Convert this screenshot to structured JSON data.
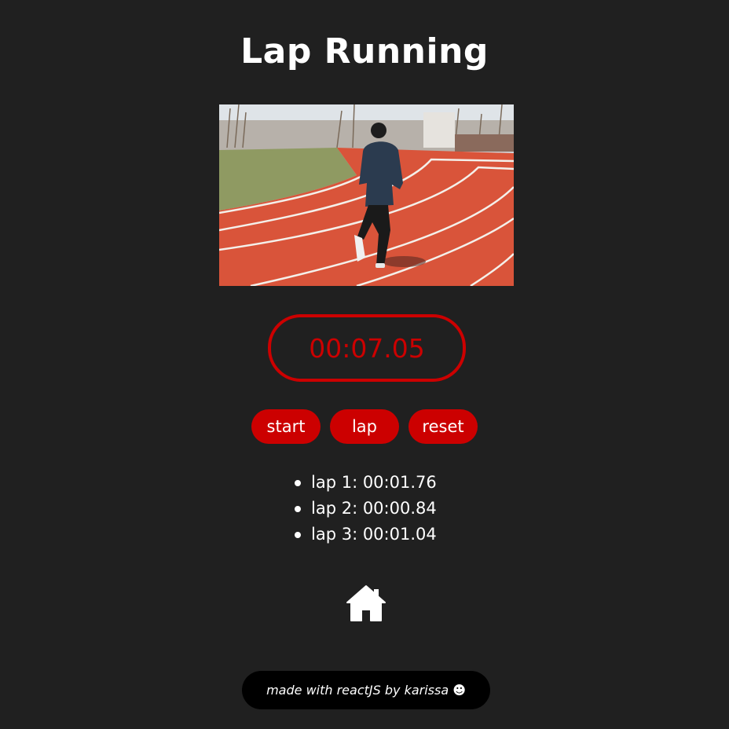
{
  "app": {
    "title": "Lap Running"
  },
  "hero_image": {
    "alt": "runner on a red running track",
    "colors": {
      "track": "#d9543a",
      "lines": "#f4f0ea",
      "grass": "#8f9a62",
      "jacket": "#2b3b4f",
      "sky": "#dfe4e8"
    }
  },
  "timer": {
    "display": "00:07.05",
    "color": "#cc0000"
  },
  "controls": {
    "start_label": "start",
    "lap_label": "lap",
    "reset_label": "reset"
  },
  "laps": [
    {
      "label": "lap 1: 00:01.76"
    },
    {
      "label": "lap 2: 00:00.84"
    },
    {
      "label": "lap 3: 00:01.04"
    }
  ],
  "nav": {
    "home_icon": "home-icon"
  },
  "footer": {
    "text": "made with reactJS by karissa ☻"
  },
  "theme": {
    "background": "#202020",
    "accent": "#cc0000"
  }
}
